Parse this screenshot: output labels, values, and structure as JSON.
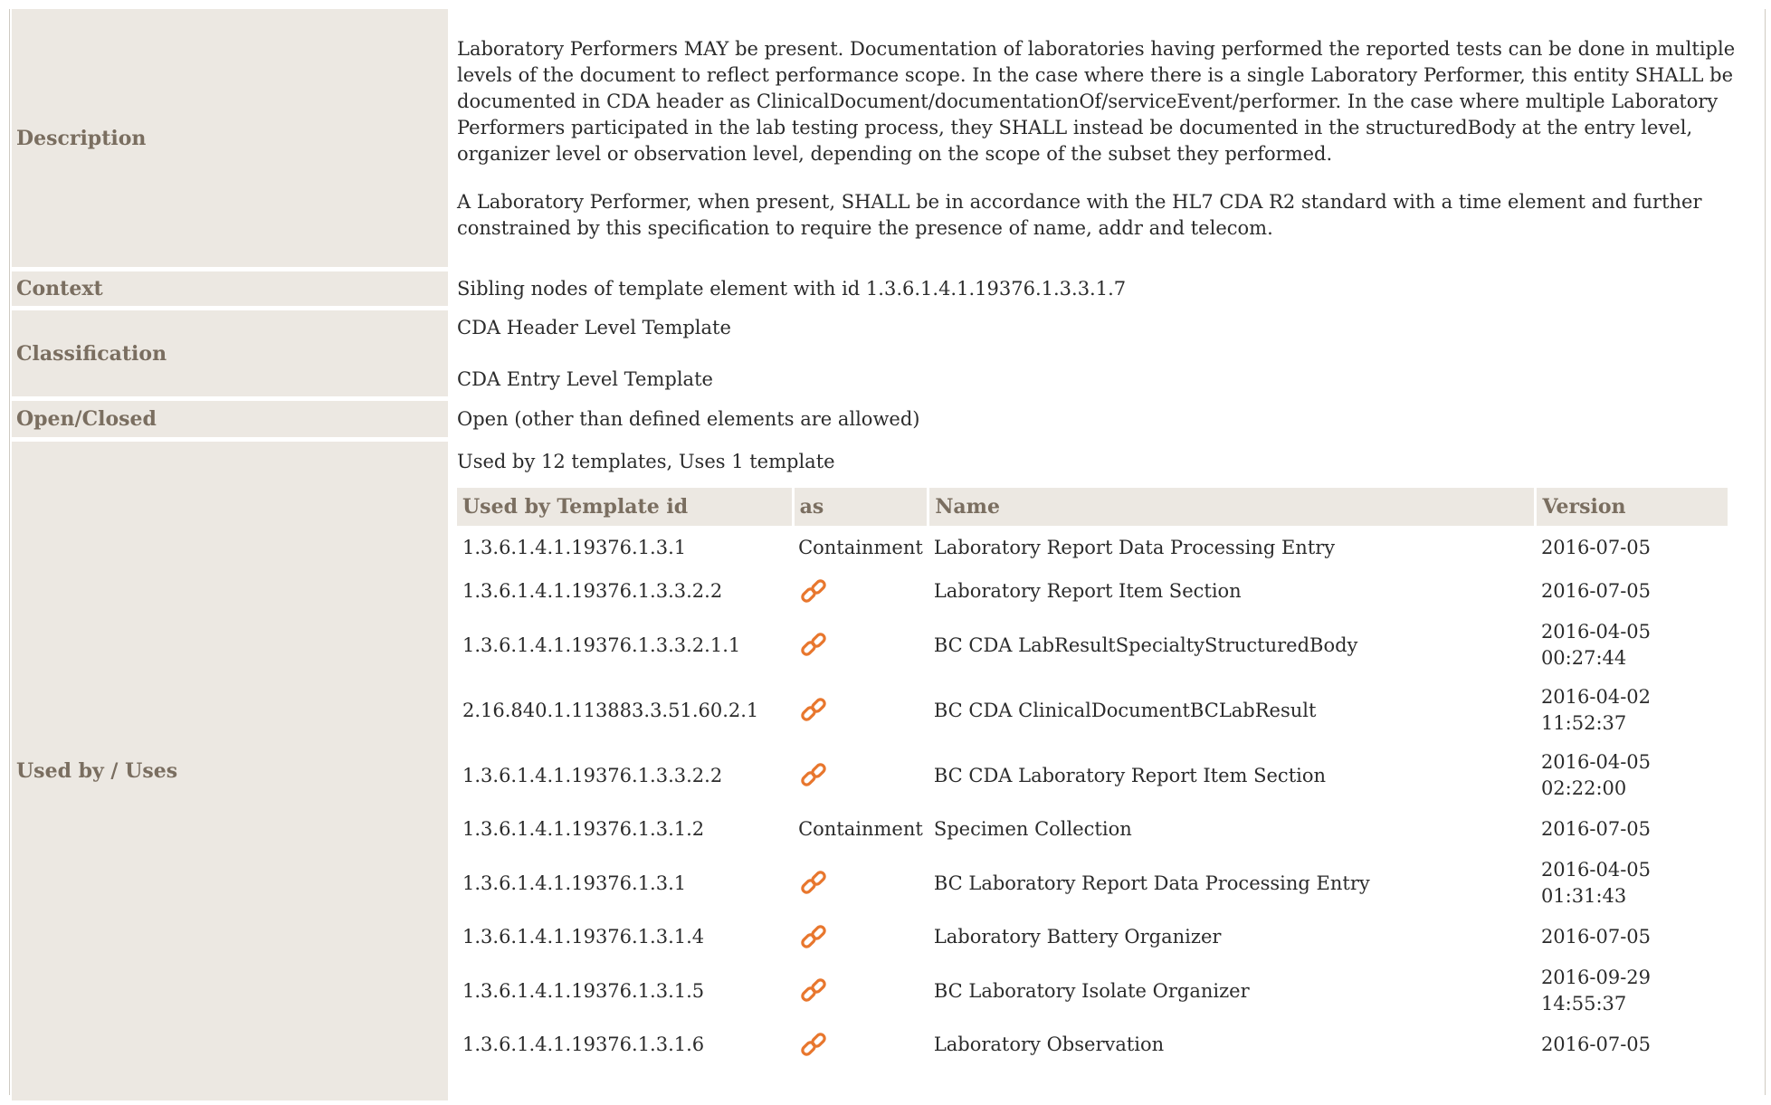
{
  "rows": {
    "description": {
      "label": "Description",
      "paragraphs": [
        "Laboratory Performers MAY be present. Documentation of laboratories having performed the reported tests can be done in multiple levels of the document to reflect performance scope. In the case where there is a single Laboratory Performer, this entity SHALL be documented in CDA header as ClinicalDocument/documentationOf/serviceEvent/performer. In the case where multiple Laboratory Performers participated in the lab testing process, they SHALL instead be documented in the structuredBody at the entry level, organizer level or observation level, depending on the scope of the subset they performed.",
        "A Laboratory Performer, when present, SHALL be in accordance with the HL7 CDA R2 standard with a time element and further constrained by this specification to require the presence of name, addr and telecom."
      ]
    },
    "context": {
      "label": "Context",
      "value": "Sibling nodes of template element with id 1.3.6.1.4.1.19376.1.3.3.1.7"
    },
    "classification": {
      "label": "Classification",
      "values": [
        "CDA Header Level Template",
        "CDA Entry Level Template"
      ]
    },
    "open_closed": {
      "label": "Open/Closed",
      "value": "Open (other than defined elements are allowed)"
    },
    "used_by": {
      "label": "Used by / Uses",
      "summary": "Used by 12 templates, Uses 1 template",
      "columns": [
        "Used by Template id",
        "as",
        "Name",
        "Version"
      ],
      "entries": [
        {
          "id": "1.3.6.1.4.1.19376.1.3.1",
          "as": "Containment",
          "name": "Laboratory Report Data Processing Entry",
          "version_1": "2016-07-05",
          "version_2": ""
        },
        {
          "id": "1.3.6.1.4.1.19376.1.3.3.2.2",
          "as": "",
          "name": "Laboratory Report Item Section",
          "version_1": "2016-07-05",
          "version_2": ""
        },
        {
          "id": "1.3.6.1.4.1.19376.1.3.3.2.1.1",
          "as": "",
          "name": "BC CDA LabResultSpecialtyStructuredBody",
          "version_1": "2016-04-05",
          "version_2": "00:27:44"
        },
        {
          "id": "2.16.840.1.113883.3.51.60.2.1",
          "as": "",
          "name": "BC CDA ClinicalDocumentBCLabResult",
          "version_1": "2016-04-02",
          "version_2": "11:52:37"
        },
        {
          "id": "1.3.6.1.4.1.19376.1.3.3.2.2",
          "as": "",
          "name": "BC CDA Laboratory Report Item Section",
          "version_1": "2016-04-05",
          "version_2": "02:22:00"
        },
        {
          "id": "1.3.6.1.4.1.19376.1.3.1.2",
          "as": "Containment",
          "name": "Specimen Collection",
          "version_1": "2016-07-05",
          "version_2": ""
        },
        {
          "id": "1.3.6.1.4.1.19376.1.3.1",
          "as": "",
          "name": "BC Laboratory Report Data Processing Entry",
          "version_1": "2016-04-05",
          "version_2": "01:31:43"
        },
        {
          "id": "1.3.6.1.4.1.19376.1.3.1.4",
          "as": "",
          "name": "Laboratory Battery Organizer",
          "version_1": "2016-07-05",
          "version_2": ""
        },
        {
          "id": "1.3.6.1.4.1.19376.1.3.1.5",
          "as": "",
          "name": "BC Laboratory Isolate Organizer",
          "version_1": "2016-09-29",
          "version_2": "14:55:37"
        },
        {
          "id": "1.3.6.1.4.1.19376.1.3.1.6",
          "as": "",
          "name": "Laboratory Observation",
          "version_1": "2016-07-05",
          "version_2": ""
        }
      ]
    }
  },
  "icons": {
    "link": "link-chain-icon"
  },
  "colors": {
    "label_bg": "#ece8e2",
    "label_text": "#7a6e60",
    "link_icon": "#e8772e"
  }
}
